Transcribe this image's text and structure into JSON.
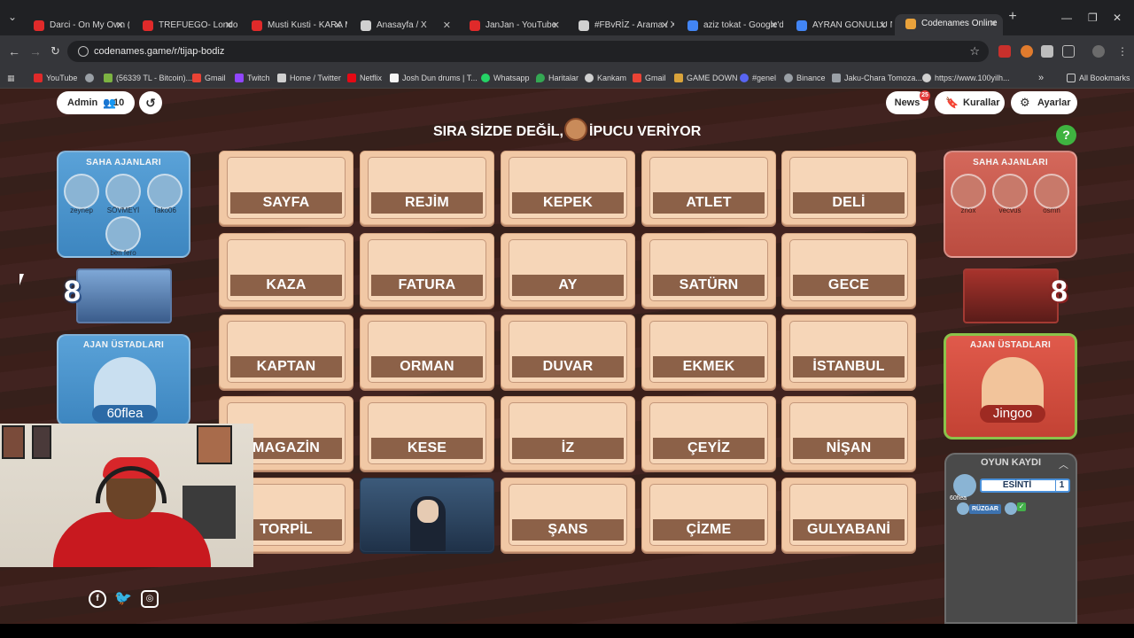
{
  "browser": {
    "tabs": [
      {
        "title": "Darci - On My Own (I",
        "color": "#e02a2a"
      },
      {
        "title": "TREFUEGO- London",
        "color": "#e02a2a"
      },
      {
        "title": "Musti Kusti - KARA M",
        "color": "#e02a2a"
      },
      {
        "title": "Anasayfa / X",
        "color": "#d0d0d0"
      },
      {
        "title": "JanJan - YouTube",
        "color": "#e02a2a"
      },
      {
        "title": "#FBvRİZ - Arama / X",
        "color": "#d0d0d0"
      },
      {
        "title": "aziz tokat - Google'd",
        "color": "#4285f4"
      },
      {
        "title": "AYRAN GONULLU NE",
        "color": "#4285f4"
      },
      {
        "title": "Codenames Online",
        "color": "#e9a23b"
      }
    ],
    "url": "codenames.game/r/tijap-bodiz",
    "bookmarks": [
      {
        "label": "YouTube",
        "color": "#e02a2a"
      },
      {
        "label": "",
        "color": "#9aa0a6"
      },
      {
        "label": "(56339 TL - Bitcoin)...",
        "color": "#7cb342"
      },
      {
        "label": "Gmail",
        "color": "#ea4335"
      },
      {
        "label": "Twitch",
        "color": "#9146ff"
      },
      {
        "label": "Home / Twitter",
        "color": "#d0d0d0"
      },
      {
        "label": "Netflix",
        "color": "#e50914"
      },
      {
        "label": "Josh Dun drums | T...",
        "color": "#f5f5f5"
      },
      {
        "label": "Whatsapp",
        "color": "#25d366"
      },
      {
        "label": "Haritalar",
        "color": "#34a853"
      },
      {
        "label": "Kankam",
        "color": "#d0d0d0"
      },
      {
        "label": "Gmail",
        "color": "#ea4335"
      },
      {
        "label": "GAME DOWN",
        "color": "#d9a33b"
      },
      {
        "label": "#genel",
        "color": "#5865f2"
      },
      {
        "label": "Binance",
        "color": "#9aa0a6"
      },
      {
        "label": "Jaku-Chara Tomoza...",
        "color": "#9aa0a6"
      },
      {
        "label": "https://www.100yilh...",
        "color": "#d0d0d0"
      }
    ],
    "all_bookmarks": "All Bookmarks"
  },
  "game": {
    "admin_label": "Admin",
    "player_count": "10",
    "news_label": "News",
    "news_badge": "25",
    "rules_label": "Kurallar",
    "settings_label": "Ayarlar",
    "status_part1": "SIRA SİZDE DEĞİL,",
    "status_part2": "İPUCU VERİYOR",
    "help_label": "?",
    "blue": {
      "agents_title": "SAHA AJANLARI",
      "agents": [
        "zeynep",
        "SÖVMEYİ",
        "Tako06",
        "ben fero"
      ],
      "remaining": "8",
      "spymaster_title": "AJAN ÜSTADLARI",
      "spymaster": "60flea"
    },
    "red": {
      "agents_title": "SAHA AJANLARI",
      "agents": [
        "znox",
        "vecvus",
        "osmn"
      ],
      "remaining": "8",
      "spymaster_title": "AJAN ÜSTADLARI",
      "spymaster": "Jingoo"
    },
    "board": [
      [
        "SAYFA",
        "REJİM",
        "KEPEK",
        "ATLET",
        "DELİ"
      ],
      [
        "KAZA",
        "FATURA",
        "AY",
        "SATÜRN",
        "GECE"
      ],
      [
        "KAPTAN",
        "ORMAN",
        "DUVAR",
        "EKMEK",
        "İSTANBUL"
      ],
      [
        "MAGAZİN",
        "KESE",
        "İZ",
        "ÇEYİZ",
        "NİŞAN"
      ],
      [
        "TORPİL",
        "",
        "ŞANS",
        "ÇİZME",
        "GULYABANİ"
      ]
    ],
    "log": {
      "title": "OYUN KAYDI",
      "clue_word": "ESİNTİ",
      "clue_number": "1",
      "clue_giver": "60flea",
      "guess_word": "RÜZGAR"
    }
  }
}
